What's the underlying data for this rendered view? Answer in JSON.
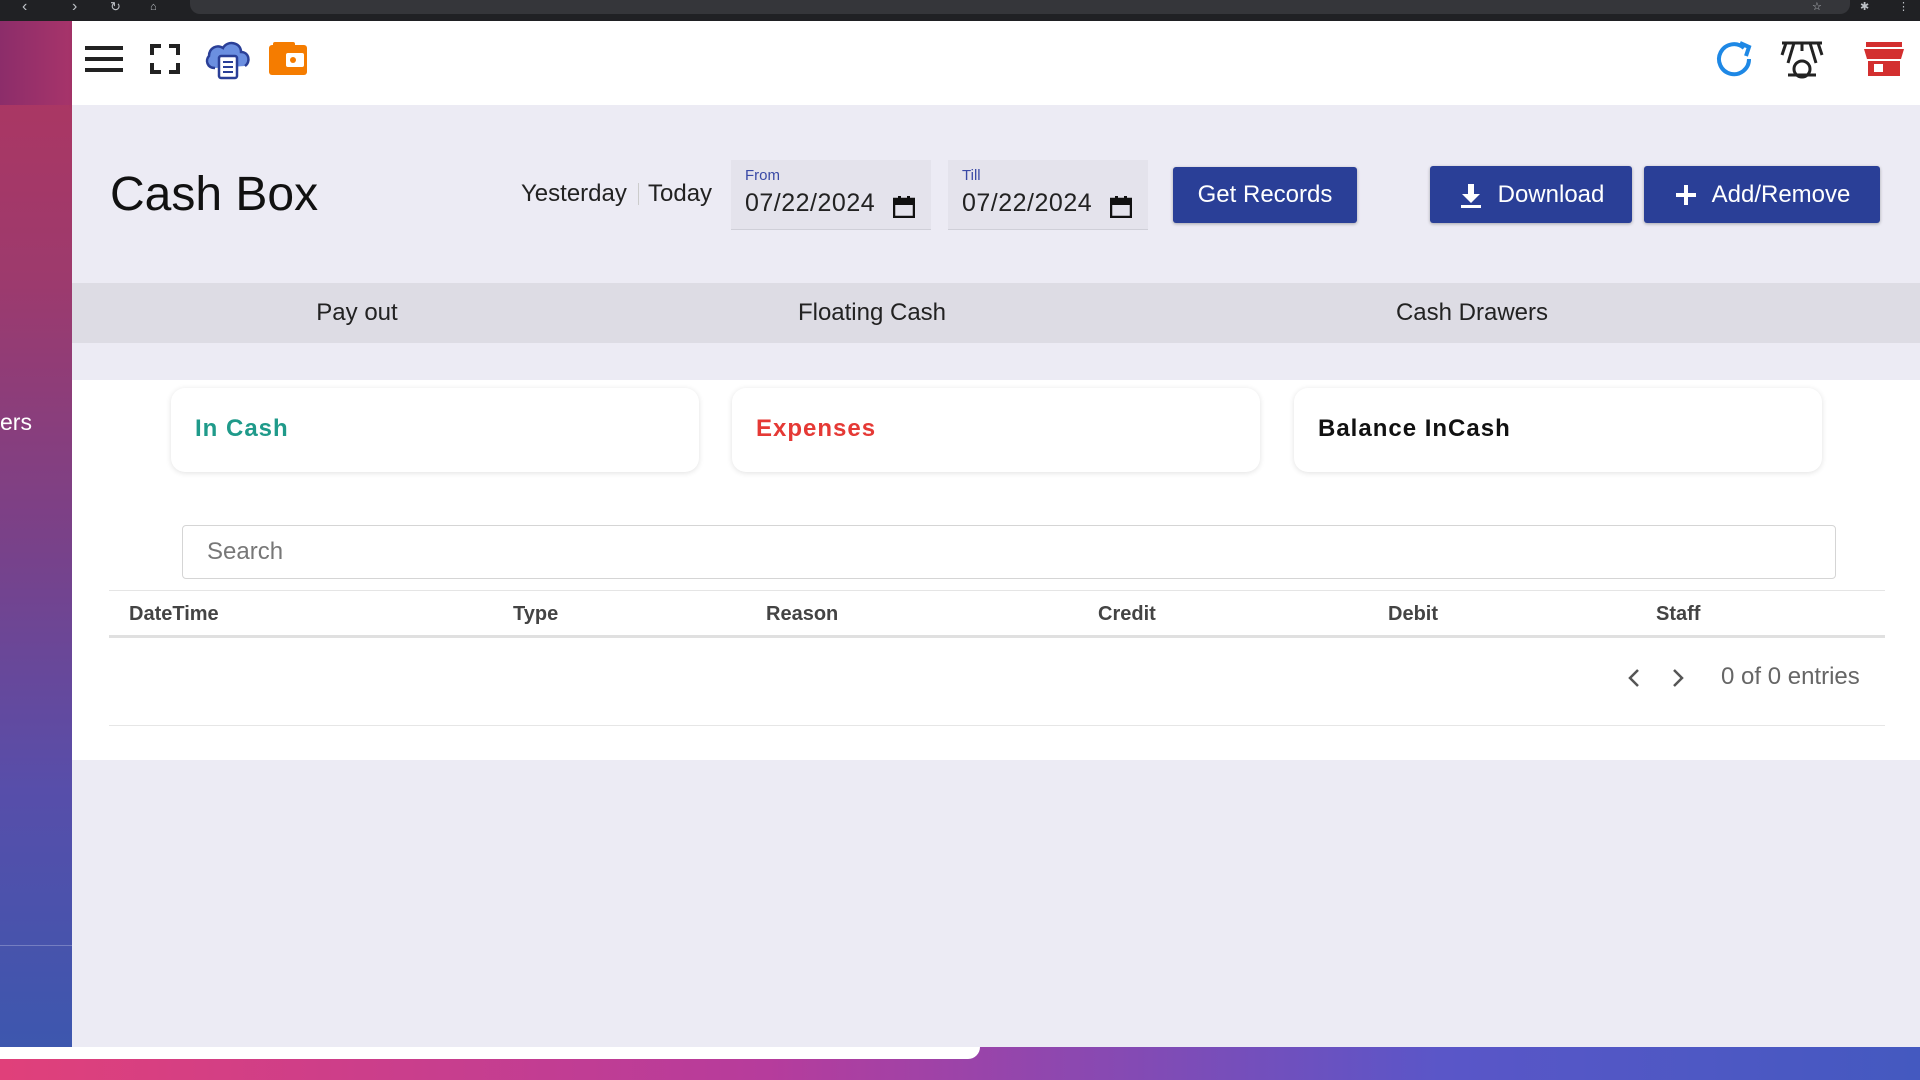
{
  "page": {
    "title": "Cash Box"
  },
  "quick_ranges": {
    "yesterday": "Yesterday",
    "today": "Today"
  },
  "dates": {
    "from_label": "From",
    "from_value": "07/22/2024",
    "till_label": "Till",
    "till_value": "07/22/2024"
  },
  "buttons": {
    "get_records": "Get Records",
    "download": "Download",
    "add_remove": "Add/Remove"
  },
  "tabs": [
    "Pay out",
    "Floating Cash",
    "Cash Drawers"
  ],
  "cards": {
    "in_cash": "In Cash",
    "expenses": "Expenses",
    "balance": "Balance InCash"
  },
  "search": {
    "placeholder": "Search"
  },
  "table": {
    "columns": [
      "DateTime",
      "Type",
      "Reason",
      "Credit",
      "Debit",
      "Staff"
    ],
    "rows": []
  },
  "pagination": {
    "summary": "0 of 0 entries"
  },
  "sidebar": {
    "peek_text": "ers"
  },
  "colors": {
    "primary": "#2a3f97",
    "in_cash": "#1f9a8a",
    "expenses": "#e53935",
    "balance": "#111111",
    "refresh_icon": "#1e88e5",
    "store_icon": "#d32f2f",
    "wallet_icon": "#f57c00"
  },
  "icons": {
    "menu": "menu-icon",
    "fullscreen": "fullscreen-icon",
    "cloud_receipt": "cloud-receipt-icon",
    "wallet": "wallet-icon",
    "refresh": "refresh-icon",
    "network": "network-icon",
    "store": "store-icon"
  }
}
